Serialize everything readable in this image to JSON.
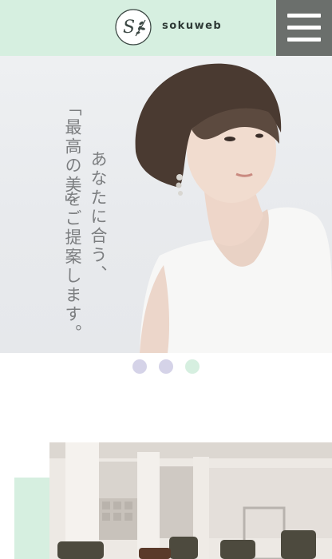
{
  "header": {
    "brand": "sokuweb",
    "logo_icon": "leaf-monogram-icon",
    "menu_icon": "hamburger-menu-icon"
  },
  "hero": {
    "tagline_line1": "あなたに合う、",
    "tagline_line2": "「最高の美」",
    "tagline_line3": "をご提案します。"
  },
  "slider": {
    "dots": [
      {
        "state": "inactive",
        "color": "#d5d3e8"
      },
      {
        "state": "inactive",
        "color": "#d5d3e8"
      },
      {
        "state": "active",
        "color": "#d6efe0"
      }
    ]
  },
  "colors": {
    "accent_mint": "#d6efe0",
    "menu_gray": "#6b6f6c"
  }
}
